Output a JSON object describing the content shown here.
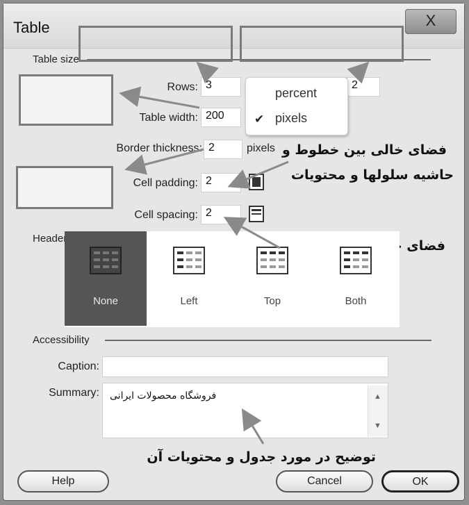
{
  "dialog": {
    "title": "Table",
    "close_label": "X"
  },
  "table_size": {
    "section_label": "Table size",
    "rows_label": "Rows:",
    "rows_value": "3",
    "columns_value": "2",
    "width_label": "Table width:",
    "width_value": "200",
    "width_unit_options": [
      "percent",
      "pixels"
    ],
    "width_unit_selected": "pixels",
    "border_label": "Border thickness:",
    "border_value": "2",
    "border_unit": "pixels",
    "padding_label": "Cell padding:",
    "padding_value": "2",
    "spacing_label": "Cell spacing:",
    "spacing_value": "2"
  },
  "header": {
    "section_label": "Header",
    "options": [
      {
        "label": "None",
        "icon": "table-no-header-icon"
      },
      {
        "label": "Left",
        "icon": "table-left-header-icon"
      },
      {
        "label": "Top",
        "icon": "table-top-header-icon"
      },
      {
        "label": "Both",
        "icon": "table-both-header-icon"
      }
    ],
    "selected": "None"
  },
  "accessibility": {
    "section_label": "Accessibility",
    "caption_label": "Caption:",
    "caption_value": "",
    "summary_label": "Summary:",
    "summary_value": "فروشگاه محصولات ایرانی"
  },
  "annotations": {
    "padding_note_line1": "فضای خالی بین خطوط و",
    "padding_note_line2": "حاشیه سلولها و محتویات",
    "spacing_note": "فضای خالی بین سلولها",
    "summary_note": "توضیح در مورد جدول و محتویات آن"
  },
  "buttons": {
    "help": "Help",
    "cancel": "Cancel",
    "ok": "OK"
  },
  "colors": {
    "selected_header_bg": "#555555",
    "annotation_border": "#7a7a7a",
    "arrow": "#888888"
  }
}
